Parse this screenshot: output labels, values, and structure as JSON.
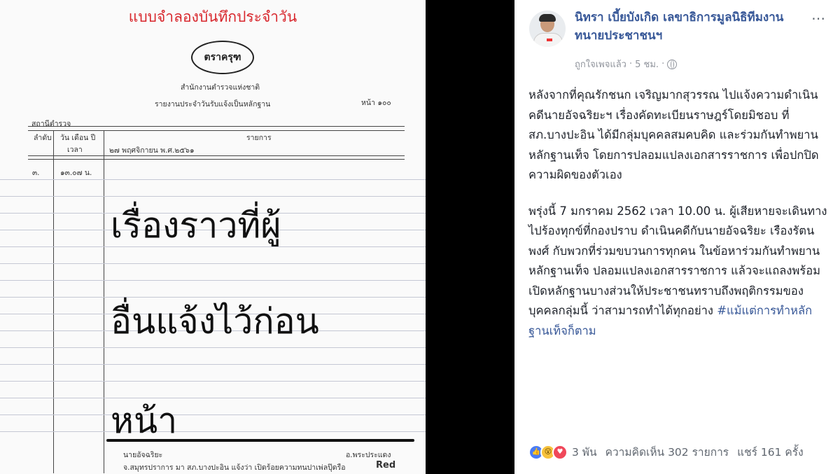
{
  "document": {
    "header_title": "แบบจำลองบันทึกประจำวัน",
    "seal_text": "ตราครุฑ",
    "agency_line1": "สำนักงานตำรวจแห่งชาติ",
    "agency_line2": "รายงานประจำวันรับแจ้งเป็นหลักฐาน",
    "page_label": "หน้า ๑๐๐",
    "station_label": "สถานีตำรวจ",
    "col_no": "ลำดับ",
    "col_date_line1": "วัน เดือน ปี",
    "col_date_line2": "เวลา",
    "col_items": "รายการ",
    "date_entry": "๒๗ พฤศจิกายน พ.ศ.๒๕๖๑",
    "row_number": "๓.",
    "row_time": "๑๓.๐๗ น.",
    "overlay_line1": "เรื่องราวที่ผู้",
    "overlay_line2": "อื่นแจ้งไว้ก่อน",
    "overlay_line3": "หน้า",
    "bottom_line1_left": "นายอัจฉริยะ",
    "bottom_line1_right": "อ.พระประแดง",
    "bottom_line2": "จ.สมุทรปราการ มา สภ.บางปะอิน แจ้งว่า เปิดร้อยความทนปาเพ่ลปุ๊ดรือ",
    "bottom_word": "Red"
  },
  "post": {
    "page_name": "นิทรา เบี้ยบังเกิด เลขาธิการมูลนิธิทีมงานทนายประชาชนฯ",
    "more_icon": "⋯",
    "meta_liked": "ถูกใจเพจแล้ว",
    "meta_time": "5 ชม.",
    "paragraph1": "หลังจากที่คุณรักชนก เจริญมากสุวรรณ ไปแจ้งความดำเนินคดีนายอัจฉริยะฯ เรื่องคัดทะเบียนราษฎร์โดยมิชอบ ที่สภ.บางปะอิน ได้มีกลุ่มบุคคลสมคบคิด และร่วมกันทำพยานหลักฐานเท็จ โดยการปลอมแปลงเอกสารราชการ เพื่อปกปิดความผิดของตัวเอง",
    "paragraph2": "พรุ่งนี้ 7 มกราคม 2562 เวลา 10.00 น. ผู้เสียหายจะเดินทางไปร้องทุกข์ที่กองปราบ ดำเนินคดีกับนายอัจฉริยะ เรืองรัตนพงศ์ กับพวกที่ร่วมขบวนการทุกคน ในข้อหาร่วมกันทำพยานหลักฐานเท็จ ปลอมแปลงเอกสารราชการ แล้วจะแถลงพร้อมเปิดหลักฐานบางส่วนให้ประชาชนทราบถึงพฤติกรรมของบุคคลกลุ่มนี้ ว่าสามารถทำได้ทุกอย่าง",
    "hashtag": "#แม้แต่การทำหลักฐานเท็จก็ตาม",
    "reactions_count": "3 พัน",
    "comments": "ความคิดเห็น 302 รายการ",
    "shares": "แชร์ 161 ครั้ง",
    "colors": {
      "link": "#385898",
      "doc_title_red": "#d8262c"
    }
  }
}
